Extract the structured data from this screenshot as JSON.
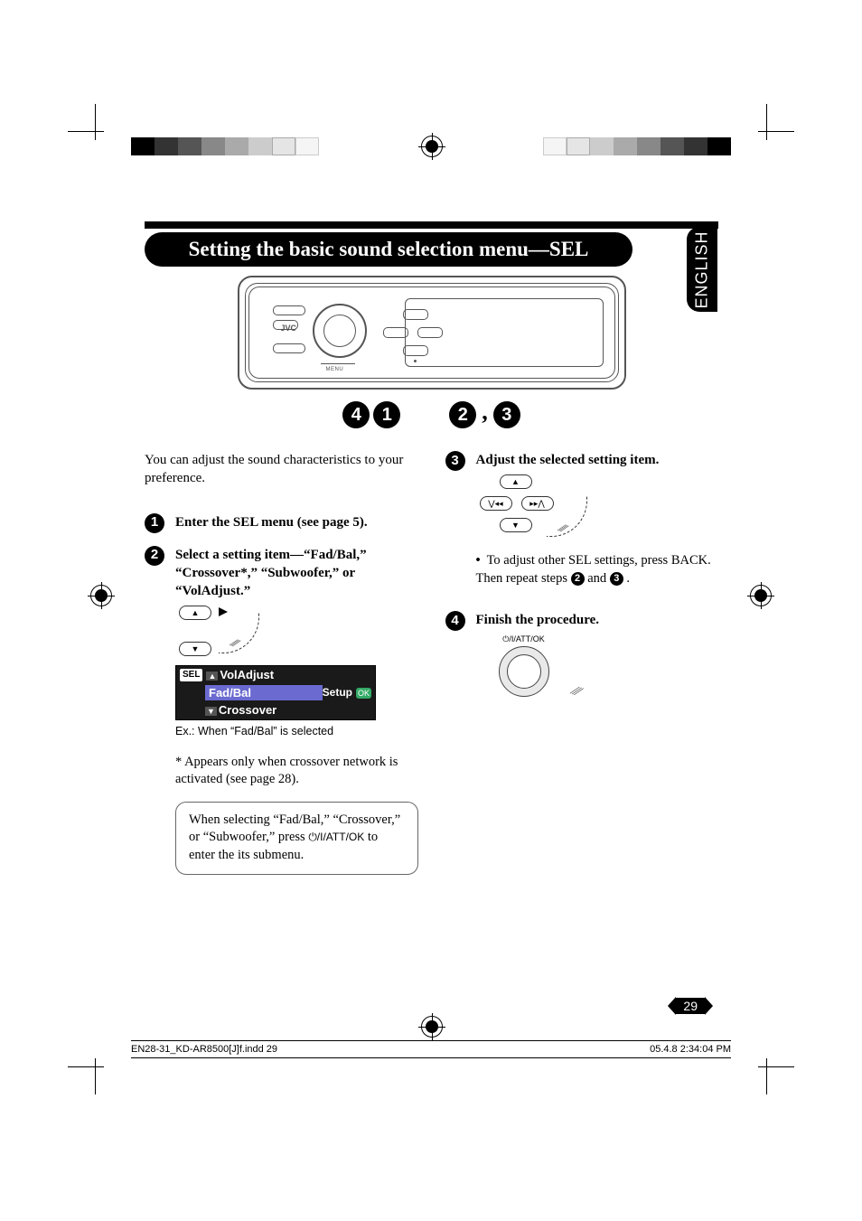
{
  "language_tab": "ENGLISH",
  "title": "Setting the basic sound selection menu—SEL",
  "device": {
    "brand": "JVC",
    "menu_label": "MENU"
  },
  "callouts": {
    "n1": "1",
    "n2": "2",
    "n3": "3",
    "n4": "4",
    "comma": ","
  },
  "intro": "You can adjust the sound characteristics to your preference.",
  "step1": {
    "text": "Enter the SEL menu (see page 5)."
  },
  "step2": {
    "text": "Select a setting item—“Fad/Bal,” “Crossover*,” “Subwoofer,” or “VolAdjust.”",
    "display": {
      "badge": "SEL",
      "item_top": "VolAdjust",
      "item_selected": "Fad/Bal",
      "item_bottom": "Crossover",
      "setup": "Setup",
      "ok": "OK"
    },
    "caption": "Ex.: When “Fad/Bal” is selected",
    "footnote": "* Appears only when crossover network is activated (see page 28).",
    "note_line1": "When selecting “Fad/Bal,” “Crossover,” or “Subwoofer,” press ",
    "note_power": "⏻/I/ATT/OK",
    "note_line2": " to enter the its submenu."
  },
  "step3": {
    "text": "Adjust the selected setting item.",
    "bullet": "To adjust other SEL settings, press BACK. Then repeat steps ",
    "and": " and ",
    "period": "."
  },
  "step4": {
    "text": "Finish the procedure.",
    "power_label": "⏻/I/ATT/OK"
  },
  "page_number": "29",
  "footer": {
    "left": "EN28-31_KD-AR8500[J]f.indd   29",
    "right": "05.4.8   2:34:04 PM"
  }
}
